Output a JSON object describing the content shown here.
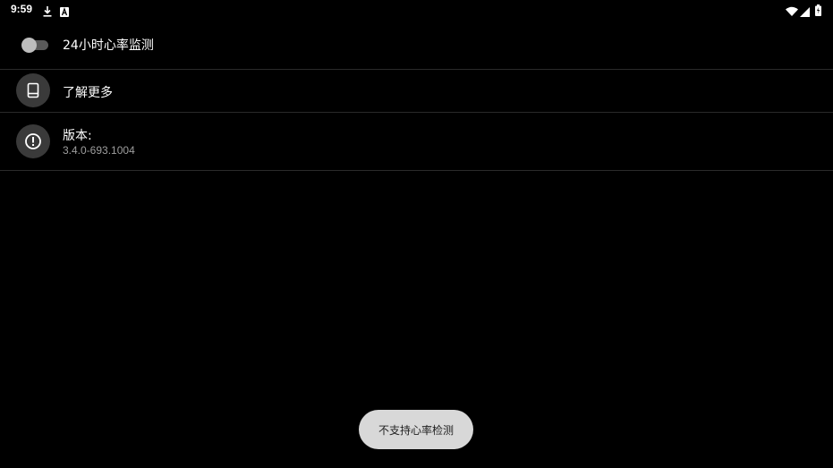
{
  "status_bar": {
    "time": "9:59",
    "left_icons": [
      "download-icon",
      "a-badge-icon"
    ],
    "right_icons": [
      "wifi-icon",
      "cell-signal-icon",
      "battery-charging-icon"
    ]
  },
  "settings": {
    "heart_rate_toggle": {
      "label": "24小时心率监测",
      "enabled": false
    },
    "learn_more": {
      "label": "了解更多",
      "icon": "book-icon"
    },
    "version": {
      "label": "版本:",
      "value": "3.4.0-693.1004",
      "icon": "info-icon"
    }
  },
  "toast": {
    "message": "不支持心率检测"
  },
  "colors": {
    "background": "#000000",
    "toast_bg": "#d8d8d8",
    "icon_circle": "#3a3a3a"
  }
}
